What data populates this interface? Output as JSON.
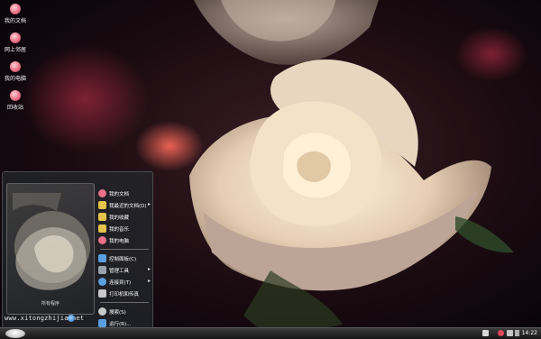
{
  "desktop": {
    "icons": [
      {
        "label": "我的文档",
        "icon": "my-documents-icon"
      },
      {
        "label": "网上邻居",
        "icon": "network-places-icon"
      },
      {
        "label": "我的电脑",
        "icon": "my-computer-icon"
      },
      {
        "label": "回收站",
        "icon": "recycle-bin-icon"
      }
    ]
  },
  "start_menu": {
    "preview_caption": "所有程序",
    "site_text": "www.xitongzhijia.net",
    "items": [
      {
        "label": "我的文档",
        "icon": "documents-icon",
        "color": "#e8708a"
      },
      {
        "label": "我最近的文档(D)",
        "icon": "recent-folder-icon",
        "color": "#e6c34a"
      },
      {
        "label": "我的收藏",
        "icon": "favorites-folder-icon",
        "color": "#e6c34a"
      },
      {
        "label": "我的音乐",
        "icon": "music-folder-icon",
        "color": "#e6c34a"
      },
      {
        "label": "我的电脑",
        "icon": "computer-icon",
        "color": "#e8708a"
      },
      {
        "label": "控制面板(C)",
        "icon": "control-panel-icon",
        "color": "#5aa0e0"
      },
      {
        "label": "管理工具",
        "icon": "admin-tools-icon",
        "color": "#9aa3ad"
      },
      {
        "label": "连接到(T)",
        "icon": "connect-icon",
        "color": "#5aa0e0"
      },
      {
        "label": "打印机和传真",
        "icon": "printer-icon",
        "color": "#c9c9c9"
      },
      {
        "label": "搜索(S)",
        "icon": "search-icon",
        "color": "#c9c9c9"
      },
      {
        "label": "运行(R)...",
        "icon": "run-icon",
        "color": "#5aa0e0"
      }
    ]
  },
  "taskbar": {
    "clock": "14:22"
  },
  "colors": {
    "menu_bg": "#22262c",
    "taskbar": "#2a2a2a"
  }
}
